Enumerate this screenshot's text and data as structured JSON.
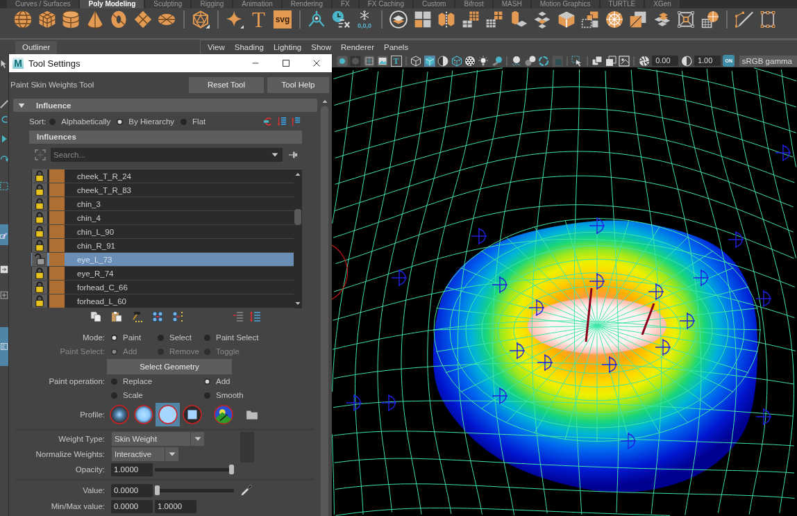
{
  "shelf": {
    "tabs": [
      {
        "label": "Curves / Surfaces",
        "selected": false
      },
      {
        "label": "Poly Modeling",
        "selected": true
      },
      {
        "label": "Sculpting",
        "selected": false
      },
      {
        "label": "Rigging",
        "selected": false
      },
      {
        "label": "Animation",
        "selected": false
      },
      {
        "label": "Rendering",
        "selected": false
      },
      {
        "label": "FX",
        "selected": false
      },
      {
        "label": "FX Caching",
        "selected": false
      },
      {
        "label": "Custom",
        "selected": false
      },
      {
        "label": "Bifrost",
        "selected": false
      },
      {
        "label": "MASH",
        "selected": false
      },
      {
        "label": "Motion Graphics",
        "selected": false
      },
      {
        "label": "TURTLE",
        "selected": false
      },
      {
        "label": "XGen",
        "selected": false
      }
    ],
    "type_tool": "T",
    "svg_tool": "svg",
    "snap_value": "0,0,0"
  },
  "outliner_tab": {
    "label": "Outliner"
  },
  "panel_menu": [
    "View",
    "Shading",
    "Lighting",
    "Show",
    "Renderer",
    "Panels"
  ],
  "viewport_toolbar": {
    "text_toggle": "T",
    "shaded_selected": true,
    "exposure": "0.00",
    "gamma": "1.00",
    "color_management": {
      "label": "ON",
      "on": true
    },
    "view_transform": "sRGB gamma"
  },
  "tool_settings": {
    "logo": "M",
    "title": "Tool Settings",
    "tool_name": "Paint Skin Weights Tool",
    "buttons": [
      "Reset Tool",
      "Tool Help"
    ],
    "influence": {
      "title": "Influence",
      "expanded": true,
      "sort": {
        "label": "Sort:",
        "options": [
          {
            "label": "Alphabetically",
            "selected": false
          },
          {
            "label": "By Hierarchy",
            "selected": true
          },
          {
            "label": "Flat",
            "selected": false
          }
        ]
      },
      "influences_title": "Influences",
      "search": {
        "placeholder": "Search..."
      },
      "rows": [
        {
          "name": "cheek_T_R_24",
          "locked": true,
          "selected": false
        },
        {
          "name": "cheek_T_R_83",
          "locked": true,
          "selected": false
        },
        {
          "name": "chin_3",
          "locked": true,
          "selected": false
        },
        {
          "name": "chin_4",
          "locked": true,
          "selected": false
        },
        {
          "name": "chin_L_90",
          "locked": true,
          "selected": false
        },
        {
          "name": "chin_R_91",
          "locked": true,
          "selected": false
        },
        {
          "name": "eye_L_73",
          "locked": false,
          "selected": true
        },
        {
          "name": "eye_R_74",
          "locked": true,
          "selected": false
        },
        {
          "name": "forhead_C_66",
          "locked": true,
          "selected": false
        },
        {
          "name": "forhead_L_60",
          "locked": true,
          "selected": false
        }
      ]
    },
    "mode": {
      "label": "Mode:",
      "options": [
        {
          "label": "Paint",
          "selected": true
        },
        {
          "label": "Select",
          "selected": false
        },
        {
          "label": "Paint Select",
          "selected": false
        }
      ]
    },
    "paint_select": {
      "label": "Paint Select:",
      "disabled": true,
      "options": [
        {
          "label": "Add",
          "selected": true
        },
        {
          "label": "Remove",
          "selected": false
        },
        {
          "label": "Toggle",
          "selected": false
        }
      ]
    },
    "select_geometry": "Select Geometry",
    "paint_operation": {
      "label": "Paint operation:",
      "options": [
        {
          "label": "Replace",
          "selected": false
        },
        {
          "label": "Add",
          "selected": true
        },
        {
          "label": "Scale",
          "selected": false
        },
        {
          "label": "Smooth",
          "selected": false
        }
      ]
    },
    "profile": {
      "label": "Profile:",
      "brushes": [
        {
          "kind": "gaussian",
          "selected": false
        },
        {
          "kind": "soft",
          "selected": false
        },
        {
          "kind": "solid",
          "selected": true
        },
        {
          "kind": "square",
          "selected": false
        },
        {
          "kind": "image",
          "selected": false
        }
      ]
    },
    "weight_type": {
      "label": "Weight Type:",
      "value": "Skin Weight"
    },
    "normalize_weights": {
      "label": "Normalize Weights:",
      "value": "Interactive"
    },
    "opacity": {
      "label": "Opacity:",
      "value": "1.0000",
      "level": 1
    },
    "value": {
      "label": "Value:",
      "value": "0.0000",
      "level": 0
    },
    "min_max": {
      "label": "Min/Max value:",
      "min": "0.0000",
      "max": "1.0000"
    }
  }
}
